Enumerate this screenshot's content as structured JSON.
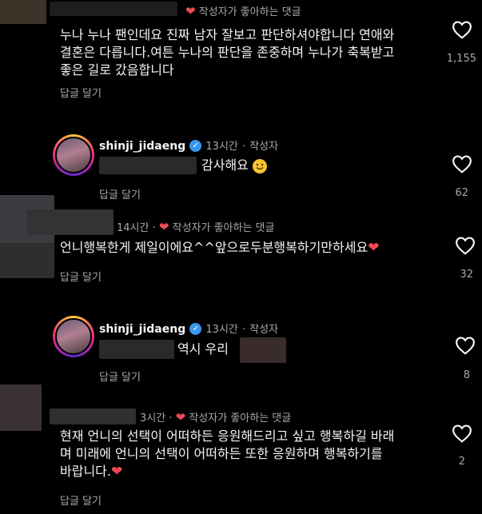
{
  "comments": [
    {
      "badge": "작성자가 좋아하는 댓글",
      "text_lines": [
        "누나 누나 팬인데요 진짜 남자 잘보고 판단하셔야합니다 연애와",
        "결혼은 다릅니다.여튼 누나의 판단을 존중하며 누나가 축복받고",
        "좋은 길로 갔음합니다"
      ],
      "reply_label": "답글 달기",
      "likes": "1,155"
    },
    {
      "username": "shinji_jidaeng",
      "time": "13시간",
      "author_tag": "작성자",
      "text": "감사해요",
      "reply_label": "답글 달기",
      "likes": "62"
    },
    {
      "time": "14시간",
      "badge": "작성자가 좋아하는 댓글",
      "text": "언니행복한게 제일이에요^^앞으로두분행복하기만하세요",
      "reply_label": "답글 달기",
      "likes": "32"
    },
    {
      "username": "shinji_jidaeng",
      "time": "13시간",
      "author_tag": "작성자",
      "text": "역시 우리",
      "reply_label": "답글 달기",
      "likes": "8"
    },
    {
      "time": "3시간",
      "badge": "작성자가 좋아하는 댓글",
      "text_lines": [
        "현재 언니의 선택이 어떠하든 응원해드리고 싶고 행복하길 바래",
        "며 미래에 언니의 선택이 어떠하든 또한 응원하며 행복하기를",
        "바랍니다."
      ],
      "reply_label": "답글 달기",
      "likes": "2"
    }
  ],
  "separator": "·",
  "colors": {
    "heart_red": "#ed4956",
    "verified_blue": "#3897f0",
    "muted": "#a8a8a8"
  }
}
